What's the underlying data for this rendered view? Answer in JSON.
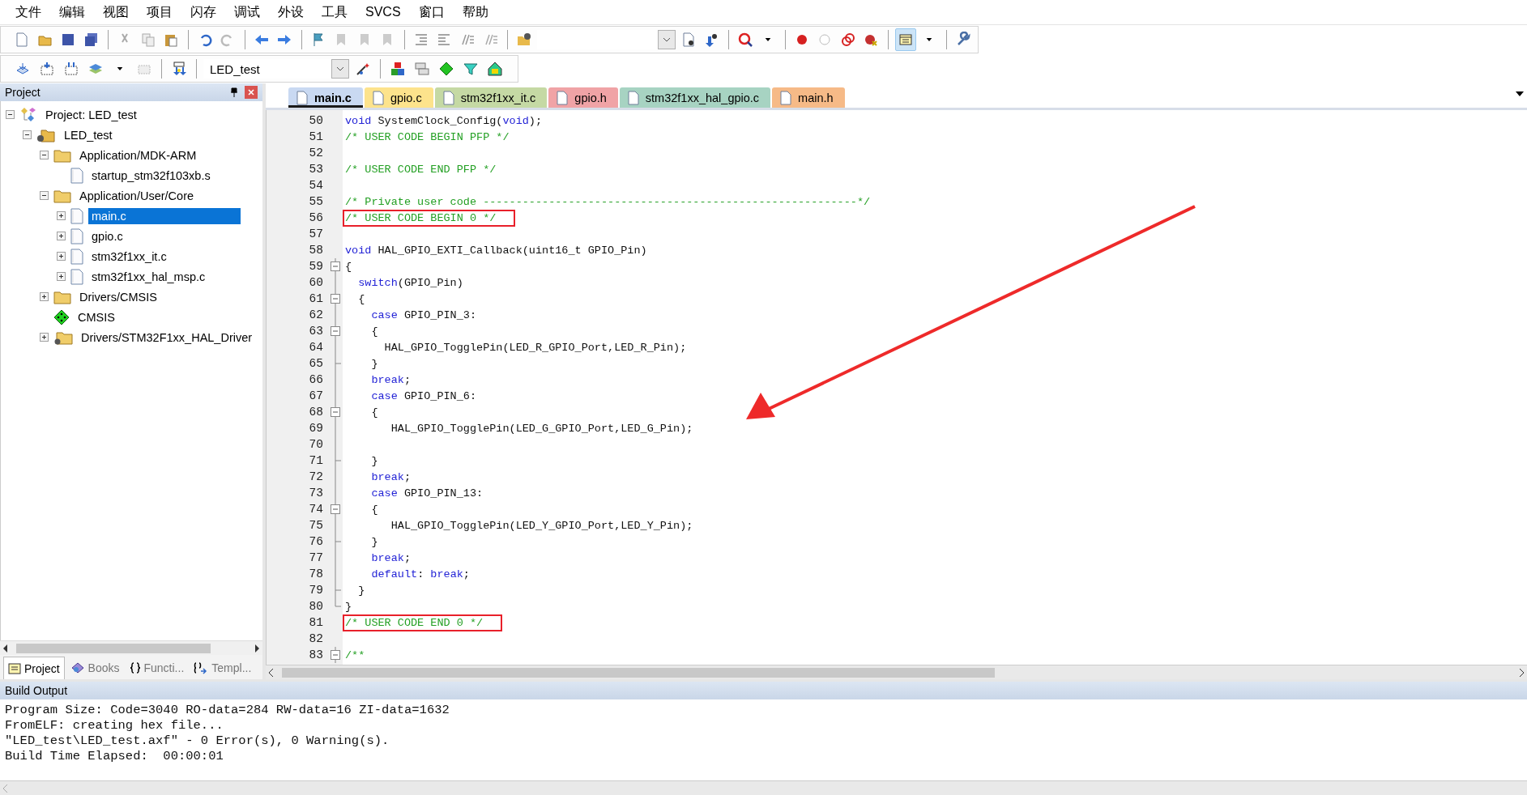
{
  "menu": [
    "文件",
    "编辑",
    "视图",
    "项目",
    "闪存",
    "调试",
    "外设",
    "工具",
    "SVCS",
    "窗口",
    "帮助"
  ],
  "target_select": {
    "value": "LED_test"
  },
  "project_panel": {
    "title": "Project",
    "tree": [
      {
        "label": "Project: LED_test",
        "kind": "project",
        "expanded": true,
        "selected": false,
        "children": [
          {
            "label": "LED_test",
            "kind": "target",
            "expanded": true,
            "selected": false,
            "children": [
              {
                "label": "Application/MDK-ARM",
                "kind": "folder",
                "expanded": true,
                "selected": false,
                "children": [
                  {
                    "label": "startup_stm32f103xb.s",
                    "kind": "file",
                    "selected": false
                  }
                ]
              },
              {
                "label": "Application/User/Core",
                "kind": "folder",
                "expanded": true,
                "selected": false,
                "children": [
                  {
                    "label": "main.c",
                    "kind": "file",
                    "expanded": false,
                    "selected": true
                  },
                  {
                    "label": "gpio.c",
                    "kind": "file",
                    "expanded": false,
                    "selected": false
                  },
                  {
                    "label": "stm32f1xx_it.c",
                    "kind": "file",
                    "expanded": false,
                    "selected": false
                  },
                  {
                    "label": "stm32f1xx_hal_msp.c",
                    "kind": "file",
                    "expanded": false,
                    "selected": false
                  }
                ]
              },
              {
                "label": "Drivers/CMSIS",
                "kind": "folder",
                "expanded": false,
                "selected": false
              },
              {
                "label": "CMSIS",
                "kind": "component",
                "selected": false
              },
              {
                "label": "Drivers/STM32F1xx_HAL_Driver",
                "kind": "library",
                "expanded": false,
                "selected": false
              }
            ]
          }
        ]
      }
    ],
    "tabs": [
      {
        "label": "Project",
        "selected": true
      },
      {
        "label": "Books",
        "selected": false
      },
      {
        "label": "Functi...",
        "selected": false
      },
      {
        "label": "Templ...",
        "selected": false
      }
    ]
  },
  "editor": {
    "tabs": [
      {
        "label": "main.c",
        "selected": true,
        "color": "#c9d9f2"
      },
      {
        "label": "gpio.c",
        "selected": false,
        "color": "#fde38c"
      },
      {
        "label": "stm32f1xx_it.c",
        "selected": false,
        "color": "#c5d9a4"
      },
      {
        "label": "gpio.h",
        "selected": false,
        "color": "#f0a3a6"
      },
      {
        "label": "stm32f1xx_hal_gpio.c",
        "selected": false,
        "color": "#a7d3c2"
      },
      {
        "label": "main.h",
        "selected": false,
        "color": "#f6ba87"
      }
    ],
    "lines": [
      {
        "number": "50",
        "kind": "plain",
        "tokens": [
          {
            "kind": "keyword",
            "text": "void"
          },
          {
            "kind": "plain",
            "text": " SystemClock_Config("
          },
          {
            "kind": "keyword",
            "text": "void"
          },
          {
            "kind": "plain",
            "text": ");"
          }
        ]
      },
      {
        "number": "51",
        "kind": "plain",
        "tokens": [
          {
            "kind": "comment",
            "text": "/* USER CODE BEGIN PFP */"
          }
        ]
      },
      {
        "number": "52",
        "kind": "plain"
      },
      {
        "number": "53",
        "kind": "plain",
        "tokens": [
          {
            "kind": "comment",
            "text": "/* USER CODE END PFP */"
          }
        ]
      },
      {
        "number": "54",
        "kind": "plain"
      },
      {
        "number": "55",
        "kind": "plain",
        "tokens": [
          {
            "kind": "comment",
            "text": "/* Private user code ---------------------------------------------------------*/"
          }
        ]
      },
      {
        "number": "56",
        "kind": "plain",
        "boxed": true,
        "tokens": [
          {
            "kind": "comment",
            "text": "/* USER CODE BEGIN 0 */"
          }
        ]
      },
      {
        "number": "57",
        "kind": "plain"
      },
      {
        "number": "58",
        "kind": "plain",
        "tokens": [
          {
            "kind": "keyword",
            "text": "void"
          },
          {
            "kind": "plain",
            "text": " HAL_GPIO_EXTI_Callback(uint16_t GPIO_Pin)"
          }
        ]
      },
      {
        "number": "59",
        "kind": "foldstart",
        "tokens": [
          {
            "kind": "plain",
            "text": "{"
          }
        ]
      },
      {
        "number": "60",
        "kind": "foldbody",
        "tokens": [
          {
            "kind": "keyword",
            "text": "  switch"
          },
          {
            "kind": "plain",
            "text": "(GPIO_Pin)"
          }
        ]
      },
      {
        "number": "61",
        "kind": "foldstart",
        "tokens": [
          {
            "kind": "plain",
            "text": "  {"
          }
        ]
      },
      {
        "number": "62",
        "kind": "foldbody",
        "tokens": [
          {
            "kind": "keyword",
            "text": "    case"
          },
          {
            "kind": "plain",
            "text": " GPIO_PIN_3:"
          }
        ]
      },
      {
        "number": "63",
        "kind": "foldstart",
        "tokens": [
          {
            "kind": "plain",
            "text": "    {"
          }
        ]
      },
      {
        "number": "64",
        "kind": "foldbody",
        "tokens": [
          {
            "kind": "plain",
            "text": "      HAL_GPIO_TogglePin(LED_R_GPIO_Port,LED_R_Pin);"
          }
        ]
      },
      {
        "number": "65",
        "kind": "foldend",
        "tokens": [
          {
            "kind": "plain",
            "text": "    }"
          }
        ]
      },
      {
        "number": "66",
        "kind": "foldbody",
        "tokens": [
          {
            "kind": "keyword",
            "text": "    break"
          },
          {
            "kind": "plain",
            "text": ";"
          }
        ]
      },
      {
        "number": "67",
        "kind": "foldbody",
        "tokens": [
          {
            "kind": "keyword",
            "text": "    case"
          },
          {
            "kind": "plain",
            "text": " GPIO_PIN_6:"
          }
        ]
      },
      {
        "number": "68",
        "kind": "foldstart",
        "tokens": [
          {
            "kind": "plain",
            "text": "    {"
          }
        ]
      },
      {
        "number": "69",
        "kind": "foldbody",
        "tokens": [
          {
            "kind": "plain",
            "text": "       HAL_GPIO_TogglePin(LED_G_GPIO_Port,LED_G_Pin);"
          }
        ]
      },
      {
        "number": "70",
        "kind": "foldbody"
      },
      {
        "number": "71",
        "kind": "foldend",
        "tokens": [
          {
            "kind": "plain",
            "text": "    }"
          }
        ]
      },
      {
        "number": "72",
        "kind": "foldbody",
        "tokens": [
          {
            "kind": "keyword",
            "text": "    break"
          },
          {
            "kind": "plain",
            "text": ";"
          }
        ]
      },
      {
        "number": "73",
        "kind": "foldbody",
        "tokens": [
          {
            "kind": "keyword",
            "text": "    case"
          },
          {
            "kind": "plain",
            "text": " GPIO_PIN_13:"
          }
        ]
      },
      {
        "number": "74",
        "kind": "foldstart",
        "tokens": [
          {
            "kind": "plain",
            "text": "    {"
          }
        ]
      },
      {
        "number": "75",
        "kind": "foldbody",
        "tokens": [
          {
            "kind": "plain",
            "text": "       HAL_GPIO_TogglePin(LED_Y_GPIO_Port,LED_Y_Pin);"
          }
        ]
      },
      {
        "number": "76",
        "kind": "foldend",
        "tokens": [
          {
            "kind": "plain",
            "text": "    }"
          }
        ]
      },
      {
        "number": "77",
        "kind": "foldbody",
        "tokens": [
          {
            "kind": "keyword",
            "text": "    break"
          },
          {
            "kind": "plain",
            "text": ";"
          }
        ]
      },
      {
        "number": "78",
        "kind": "foldbody",
        "tokens": [
          {
            "kind": "keyword",
            "text": "    default"
          },
          {
            "kind": "plain",
            "text": ": "
          },
          {
            "kind": "keyword",
            "text": "break"
          },
          {
            "kind": "plain",
            "text": ";"
          }
        ]
      },
      {
        "number": "79",
        "kind": "foldend",
        "tokens": [
          {
            "kind": "plain",
            "text": "  }"
          }
        ]
      },
      {
        "number": "80",
        "kind": "foldlast",
        "tokens": [
          {
            "kind": "plain",
            "text": "}"
          }
        ]
      },
      {
        "number": "81",
        "kind": "plain",
        "boxed": true,
        "tokens": [
          {
            "kind": "comment",
            "text": "/* USER CODE END 0 */"
          }
        ]
      },
      {
        "number": "82",
        "kind": "plain"
      },
      {
        "number": "83",
        "kind": "foldstart",
        "tokens": [
          {
            "kind": "comment",
            "text": "/**"
          }
        ]
      }
    ]
  },
  "build_output": {
    "title": "Build Output",
    "lines": [
      "Program Size: Code=3040 RO-data=284 RW-data=16 ZI-data=1632",
      "FromELF: creating hex file...",
      "\"LED_test\\LED_test.axf\" - 0 Error(s), 0 Warning(s).",
      "Build Time Elapsed:  00:00:01"
    ]
  }
}
